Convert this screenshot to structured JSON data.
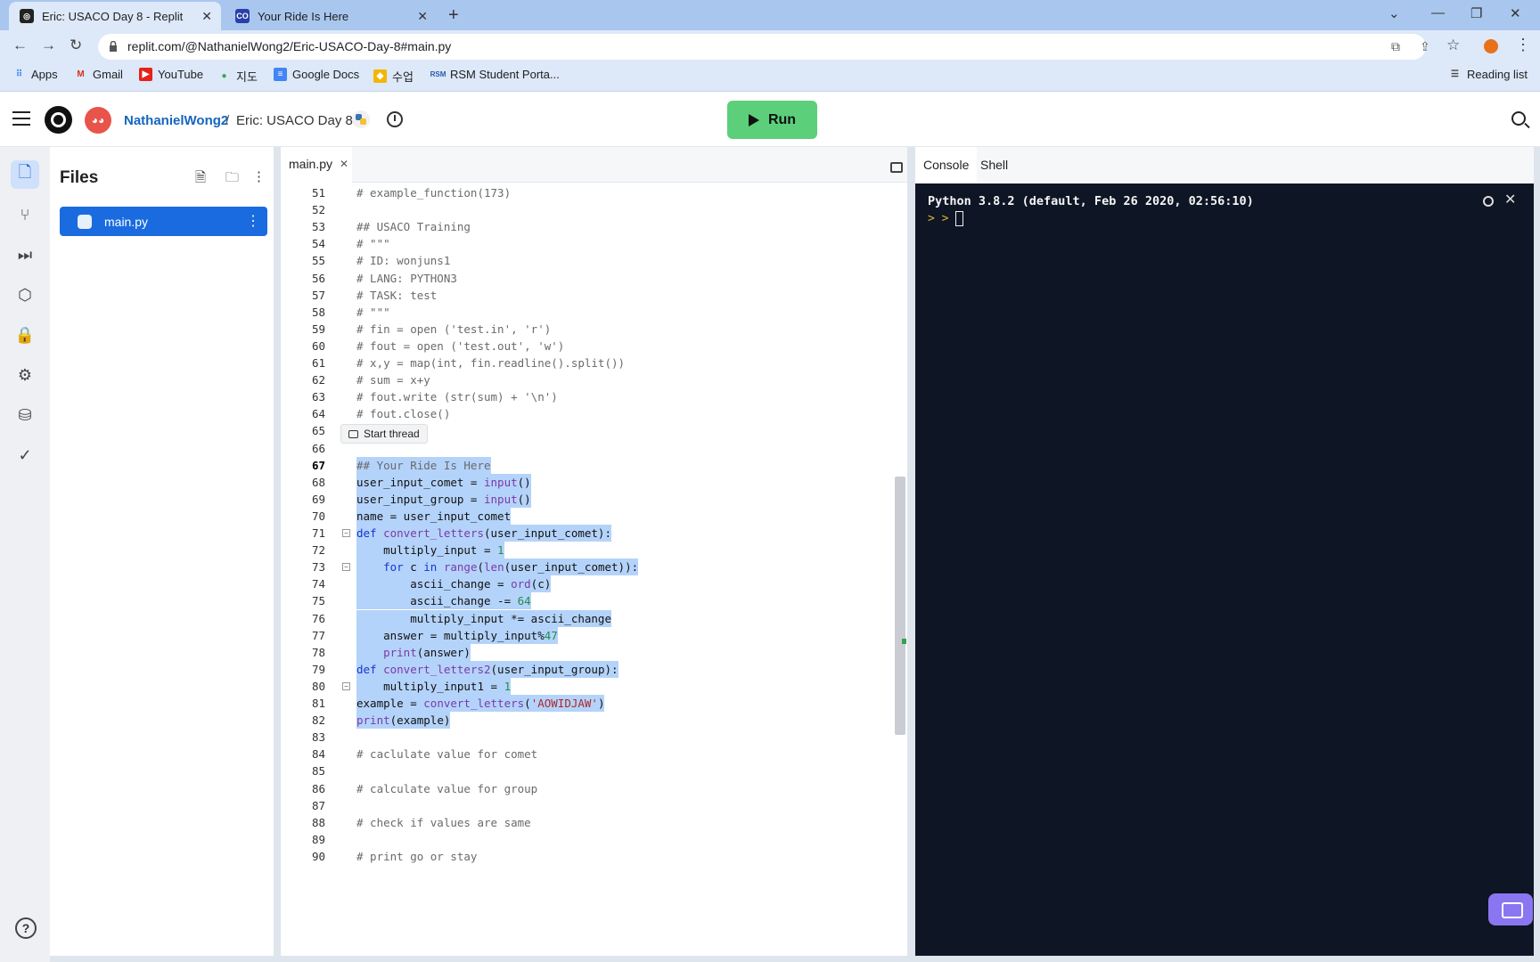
{
  "browser": {
    "tabs": [
      {
        "label": "Eric: USACO Day 8 - Replit",
        "active": true
      },
      {
        "label": "Your Ride Is Here",
        "active": false
      }
    ],
    "url": "replit.com/@NathanielWong2/Eric-USACO-Day-8#main.py",
    "bookmarks": [
      "Apps",
      "Gmail",
      "YouTube",
      "지도",
      "Google Docs",
      "수업",
      "RSM Student Porta..."
    ],
    "reading_list": "Reading list"
  },
  "header": {
    "username": "NathanielWong2",
    "separator": "/",
    "repl_name": "Eric: USACO Day 8",
    "run_label": "Run"
  },
  "files": {
    "title": "Files",
    "items": [
      {
        "name": "main.py"
      }
    ]
  },
  "editor": {
    "tab": "main.py",
    "tooltip": "Start thread",
    "lines": [
      {
        "n": "51",
        "text": "# example_function(173)"
      },
      {
        "n": "52",
        "text": ""
      },
      {
        "n": "53",
        "text": "## USACO Training"
      },
      {
        "n": "54",
        "text": "# \"\"\""
      },
      {
        "n": "55",
        "text": "# ID: wonjuns1"
      },
      {
        "n": "56",
        "text": "# LANG: PYTHON3"
      },
      {
        "n": "57",
        "text": "# TASK: test"
      },
      {
        "n": "58",
        "text": "# \"\"\""
      },
      {
        "n": "59",
        "text": "# fin = open ('test.in', 'r')"
      },
      {
        "n": "60",
        "text": "# fout = open ('test.out', 'w')"
      },
      {
        "n": "61",
        "text": "# x,y = map(int, fin.readline().split())"
      },
      {
        "n": "62",
        "text": "# sum = x+y"
      },
      {
        "n": "63",
        "text": "# fout.write (str(sum) + '\\n')"
      },
      {
        "n": "64",
        "text": "# fout.close()"
      },
      {
        "n": "65",
        "text": ""
      },
      {
        "n": "66",
        "text": ""
      },
      {
        "n": "67",
        "text": "## Your Ride Is Here"
      },
      {
        "n": "68",
        "text": "user_input_comet = input()"
      },
      {
        "n": "69",
        "text": "user_input_group = input()"
      },
      {
        "n": "70",
        "text": "name = user_input_comet"
      },
      {
        "n": "71",
        "text": "def convert_letters(user_input_comet):"
      },
      {
        "n": "72",
        "text": "    multiply_input = 1"
      },
      {
        "n": "73",
        "text": "    for c in range(len(user_input_comet)):"
      },
      {
        "n": "74",
        "text": "        ascii_change = ord(c)"
      },
      {
        "n": "75",
        "text": "        ascii_change -= 64"
      },
      {
        "n": "76",
        "text": "        multiply_input *= ascii_change"
      },
      {
        "n": "77",
        "text": "    answer = multiply_input%47"
      },
      {
        "n": "78",
        "text": "    print(answer)"
      },
      {
        "n": "79",
        "text": "def convert_letters2(user_input_group):"
      },
      {
        "n": "80",
        "text": "    multiply_input1 = 1"
      },
      {
        "n": "81",
        "text": "example = convert_letters('AOWIDJAW')"
      },
      {
        "n": "82",
        "text": "print(example)"
      },
      {
        "n": "83",
        "text": ""
      },
      {
        "n": "84",
        "text": "# caclulate value for comet"
      },
      {
        "n": "85",
        "text": ""
      },
      {
        "n": "86",
        "text": "# calculate value for group"
      },
      {
        "n": "87",
        "text": ""
      },
      {
        "n": "88",
        "text": "# check if values are same"
      },
      {
        "n": "89",
        "text": ""
      },
      {
        "n": "90",
        "text": "# print go or stay"
      }
    ]
  },
  "console": {
    "tabs": [
      "Console",
      "Shell"
    ],
    "banner": "Python 3.8.2 (default, Feb 26 2020, 02:56:10)",
    "prompt": "> >"
  }
}
